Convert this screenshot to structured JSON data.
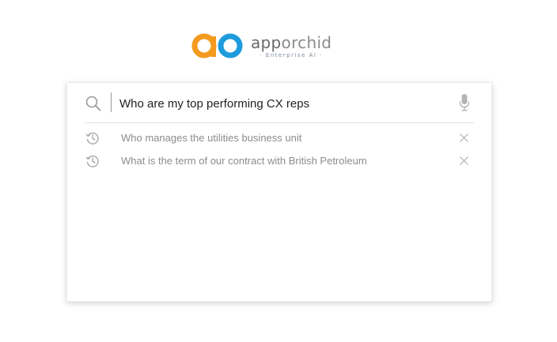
{
  "brand": {
    "name_prefix": "app",
    "name_suffix": "orchid",
    "tagline": "· Enterprise AI ·",
    "colors": {
      "orange": "#f39a1f",
      "blue": "#1e9bdc"
    }
  },
  "search": {
    "query": "Who are my top performing CX reps",
    "icon": "search-icon",
    "voice_icon": "microphone-icon"
  },
  "suggestions": [
    {
      "text": "Who manages the utilities business unit",
      "icon": "history-icon",
      "remove_icon": "close-icon"
    },
    {
      "text": "What is the term of our contract with British Petroleum",
      "icon": "history-icon",
      "remove_icon": "close-icon"
    }
  ]
}
